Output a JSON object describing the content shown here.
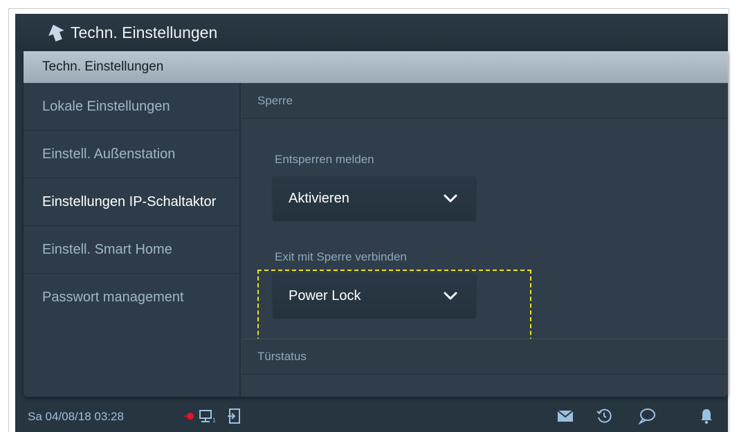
{
  "titlebar": {
    "back_icon": "back-arrow-icon",
    "title": "Techn. Einstellungen"
  },
  "panel": {
    "header": "Techn. Einstellungen"
  },
  "sidebar": {
    "items": [
      {
        "label": "Lokale Einstellungen",
        "active": false
      },
      {
        "label": "Einstell. Außenstation",
        "active": false
      },
      {
        "label": "Einstellungen IP-Schaltaktor",
        "active": true
      },
      {
        "label": "Einstell. Smart Home",
        "active": false
      },
      {
        "label": "Passwort management",
        "active": false
      }
    ]
  },
  "content": {
    "section_lock": "Sperre",
    "unlock_report_label": "Entsperren melden",
    "unlock_report_value": "Aktivieren",
    "exit_lock_label": "Exit mit Sperre verbinden",
    "exit_lock_value": "Power Lock",
    "section_door": "Türstatus"
  },
  "statusbar": {
    "datetime": "Sa 04/08/18  03:28",
    "icons": [
      "record-dot-icon",
      "network-monitor-icon",
      "door-exit-icon",
      "mail-icon",
      "history-icon",
      "chat-icon",
      "bell-icon"
    ]
  },
  "colors": {
    "background": "#273540",
    "panel_header": "#b0bfcb",
    "highlight": "#f2e21a",
    "record_dot": "#e8102a"
  }
}
